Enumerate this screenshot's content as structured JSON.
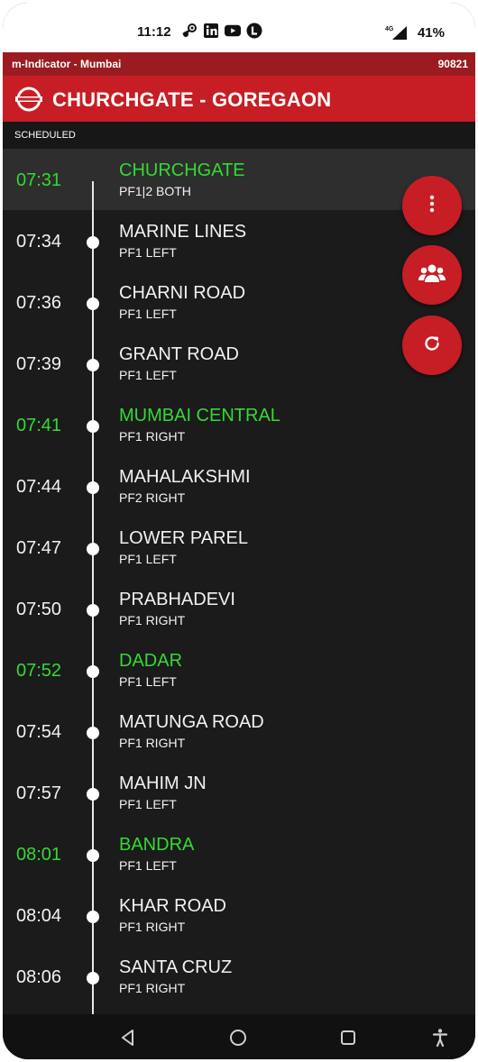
{
  "status_bar": {
    "time": "11:12",
    "network": "4G",
    "battery": "41%",
    "icons": [
      "steam-icon",
      "linkedin-icon",
      "youtube-icon",
      "l-app-icon",
      "signal-icon"
    ]
  },
  "app": {
    "name": "m-Indicator - Mumbai",
    "train_number": "90821",
    "route_title": "CHURCHGATE - GOREGAON",
    "schedule_label": "SCHEDULED"
  },
  "colors": {
    "brand_red": "#c71d24",
    "dark_red": "#9b1c20",
    "fast_station_green": "#34d934",
    "background": "#1b1b1b"
  },
  "stops": [
    {
      "time": "07:31",
      "station": "CHURCHGATE",
      "platform": "PF1|2 BOTH",
      "highlight": true
    },
    {
      "time": "07:34",
      "station": "MARINE LINES",
      "platform": "PF1 LEFT",
      "highlight": false
    },
    {
      "time": "07:36",
      "station": "CHARNI ROAD",
      "platform": "PF1 LEFT",
      "highlight": false
    },
    {
      "time": "07:39",
      "station": "GRANT ROAD",
      "platform": "PF1 LEFT",
      "highlight": false
    },
    {
      "time": "07:41",
      "station": "MUMBAI CENTRAL",
      "platform": "PF1 RIGHT",
      "highlight": true
    },
    {
      "time": "07:44",
      "station": "MAHALAKSHMI",
      "platform": "PF2 RIGHT",
      "highlight": false
    },
    {
      "time": "07:47",
      "station": "LOWER PAREL",
      "platform": "PF1 LEFT",
      "highlight": false
    },
    {
      "time": "07:50",
      "station": "PRABHADEVI",
      "platform": "PF1 RIGHT",
      "highlight": false
    },
    {
      "time": "07:52",
      "station": "DADAR",
      "platform": "PF1 LEFT",
      "highlight": true
    },
    {
      "time": "07:54",
      "station": "MATUNGA ROAD",
      "platform": "PF1 RIGHT",
      "highlight": false
    },
    {
      "time": "07:57",
      "station": "MAHIM JN",
      "platform": "PF1 LEFT",
      "highlight": false
    },
    {
      "time": "08:01",
      "station": "BANDRA",
      "platform": "PF1 LEFT",
      "highlight": true
    },
    {
      "time": "08:04",
      "station": "KHAR ROAD",
      "platform": "PF1 RIGHT",
      "highlight": false
    },
    {
      "time": "08:06",
      "station": "SANTA CRUZ",
      "platform": "PF1 RIGHT",
      "highlight": false
    }
  ],
  "fabs": [
    {
      "icon": "more-vertical-icon"
    },
    {
      "icon": "group-icon"
    },
    {
      "icon": "refresh-icon"
    }
  ],
  "nav": {
    "icons": [
      "back-icon",
      "home-icon",
      "recents-icon",
      "accessibility-icon"
    ]
  }
}
